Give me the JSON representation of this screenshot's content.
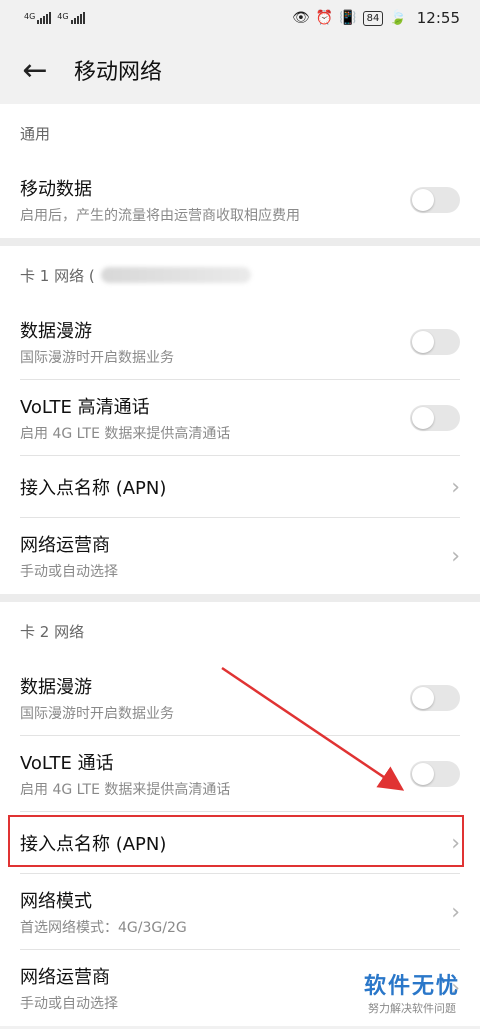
{
  "status": {
    "left_sig1": "4G",
    "left_sig2": "4G",
    "battery": "84",
    "time": "12:55"
  },
  "header": {
    "title": "移动网络"
  },
  "general": {
    "label": "通用",
    "mobile_data": {
      "title": "移动数据",
      "desc": "启用后，产生的流量将由运营商收取相应费用"
    }
  },
  "sim1": {
    "label": "卡 1 网络 (",
    "roaming": {
      "title": "数据漫游",
      "desc": "国际漫游时开启数据业务"
    },
    "volte": {
      "title": "VoLTE 高清通话",
      "desc": "启用 4G LTE 数据来提供高清通话"
    },
    "apn": {
      "title": "接入点名称 (APN)"
    },
    "carrier": {
      "title": "网络运营商",
      "desc": "手动或自动选择"
    }
  },
  "sim2": {
    "label": "卡 2 网络",
    "roaming": {
      "title": "数据漫游",
      "desc": "国际漫游时开启数据业务"
    },
    "volte": {
      "title": "VoLTE 通话",
      "desc": "启用 4G LTE 数据来提供高清通话"
    },
    "apn": {
      "title": "接入点名称 (APN)"
    },
    "mode": {
      "title": "网络模式",
      "desc": "首选网络模式：4G/3G/2G"
    },
    "carrier": {
      "title": "网络运营商",
      "desc": "手动或自动选择"
    }
  },
  "watermark": {
    "main": "软件无忧",
    "sub": "努力解决软件问题"
  },
  "colors": {
    "highlight": "#e03333",
    "arrow": "#e03333",
    "toggle_off": "#e6e6e6"
  }
}
